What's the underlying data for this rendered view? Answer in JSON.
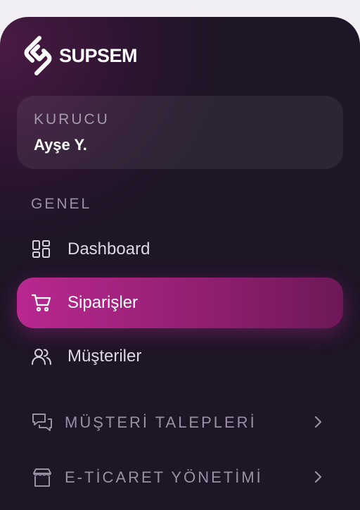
{
  "brand": {
    "name": "SUPSEM"
  },
  "user": {
    "role": "KURUCU",
    "name": "Ayşe Y."
  },
  "sections": {
    "general_label": "GENEL"
  },
  "nav": {
    "items": [
      {
        "label": "Dashboard",
        "icon": "dashboard-grid-icon",
        "active": false
      },
      {
        "label": "Siparişler",
        "icon": "shopping-cart-icon",
        "active": true
      },
      {
        "label": "Müşteriler",
        "icon": "users-icon",
        "active": false
      }
    ]
  },
  "groups": [
    {
      "label": "MÜŞTERİ TALEPLERİ",
      "icon": "chat-bubbles-icon"
    },
    {
      "label": "E-TİCARET YÖNETİMİ",
      "icon": "store-icon"
    }
  ],
  "colors": {
    "accent": "#b8288f",
    "sidebar_bg": "#1d1525",
    "page_bg": "#f2eff4"
  }
}
